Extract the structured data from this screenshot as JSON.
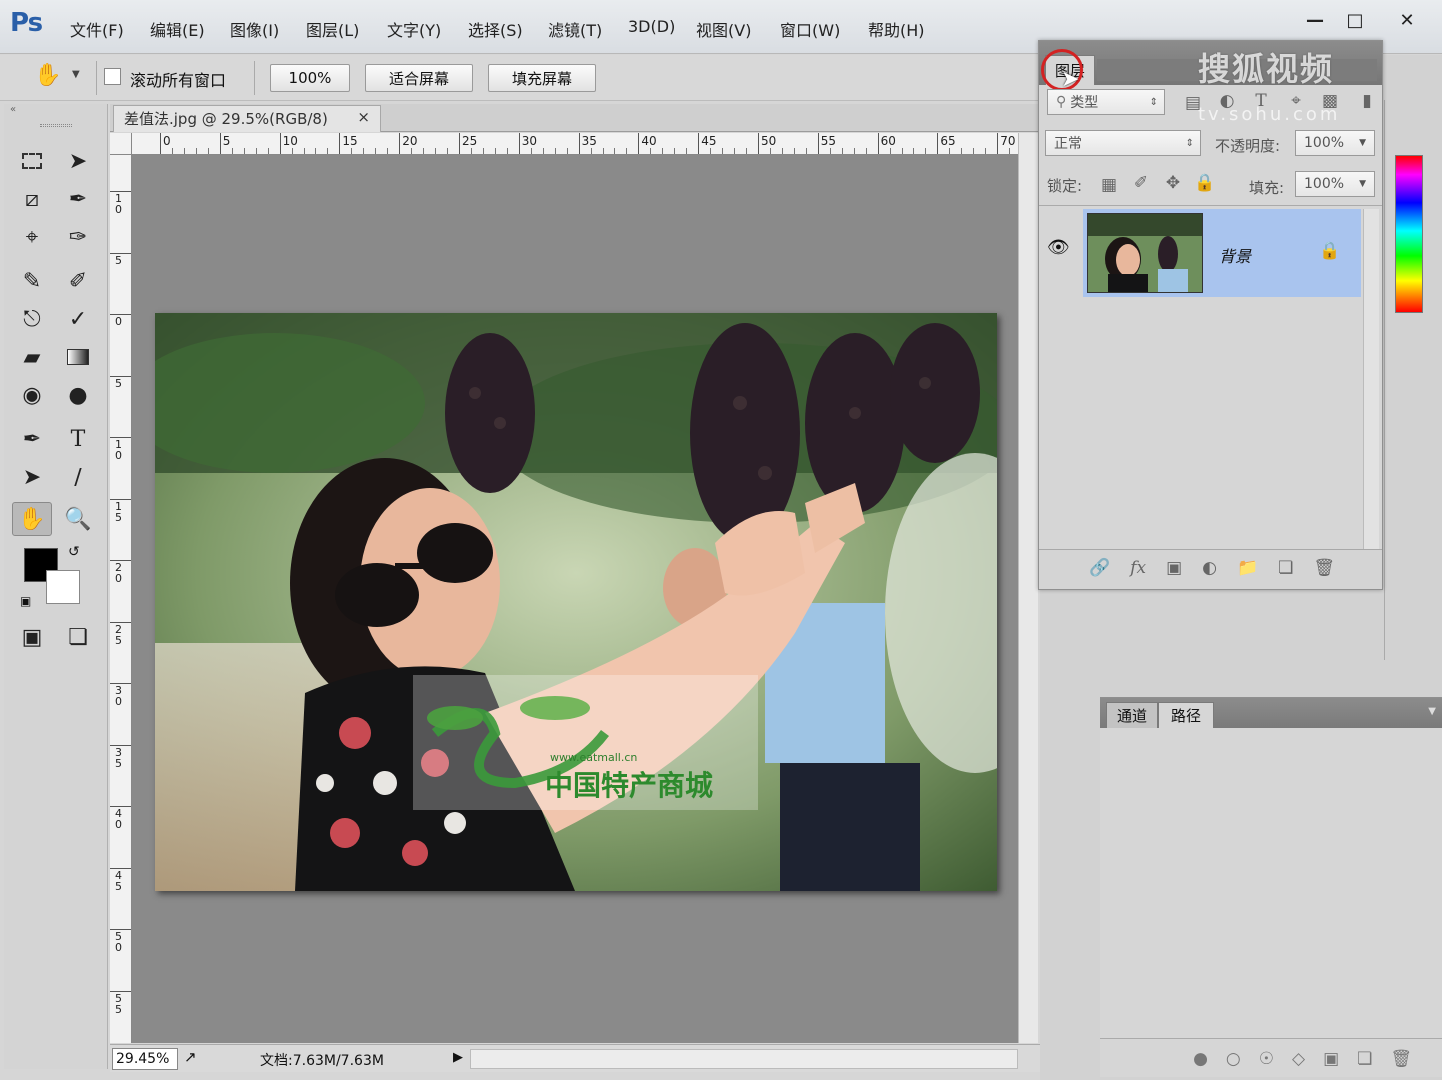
{
  "app": {
    "logo": "Ps"
  },
  "menu": {
    "items": [
      "文件(F)",
      "编辑(E)",
      "图像(I)",
      "图层(L)",
      "文字(Y)",
      "选择(S)",
      "滤镜(T)",
      "3D(D)",
      "视图(V)",
      "窗口(W)",
      "帮助(H)"
    ]
  },
  "window_controls": {
    "minimize": "—",
    "maximize": "□",
    "close": "✕"
  },
  "options_bar": {
    "scroll_all_label": "滚动所有窗口",
    "scroll_all_checked": false,
    "zoom_100_label": "100%",
    "fit_screen_label": "适合屏幕",
    "fill_screen_label": "填充屏幕"
  },
  "document": {
    "tab_title": "差值法.jpg @ 29.5%(RGB/8)",
    "tab_close": "×",
    "ruler_top_ticks": [
      "0",
      "5",
      "10",
      "15",
      "20",
      "25",
      "30",
      "35",
      "40",
      "45",
      "50",
      "55",
      "60",
      "65",
      "70"
    ],
    "ruler_left_ticks": [
      "1\n0",
      "5",
      "0",
      "5",
      "1\n0",
      "1\n5",
      "2\n0",
      "2\n5",
      "3\n0",
      "3\n5",
      "4\n0",
      "4\n5",
      "5\n0",
      "5\n5"
    ],
    "photo_watermark_url": "www.eatmall.cn",
    "photo_watermark_text": "中国特产商城"
  },
  "status": {
    "zoom": "29.45%",
    "doc_info": "文档:7.63M/7.63M"
  },
  "layers_panel": {
    "tab_label": "图层",
    "filter_kind": "类型",
    "blend_mode": "正常",
    "opacity_label": "不透明度:",
    "opacity_value": "100%",
    "lock_label": "锁定:",
    "fill_label": "填充:",
    "fill_value": "100%",
    "layers": [
      {
        "name": "背景",
        "visible": true,
        "locked": true
      }
    ]
  },
  "channels_panel": {
    "tabs": [
      "通道",
      "路径"
    ]
  },
  "watermark": {
    "text": "搜狐视频",
    "sub": "tv.sohu.com"
  },
  "colors": {
    "accent": "#2a5fa8",
    "layer_selected": "#a9c4ee",
    "canvas_bg": "#8a8a8a"
  }
}
